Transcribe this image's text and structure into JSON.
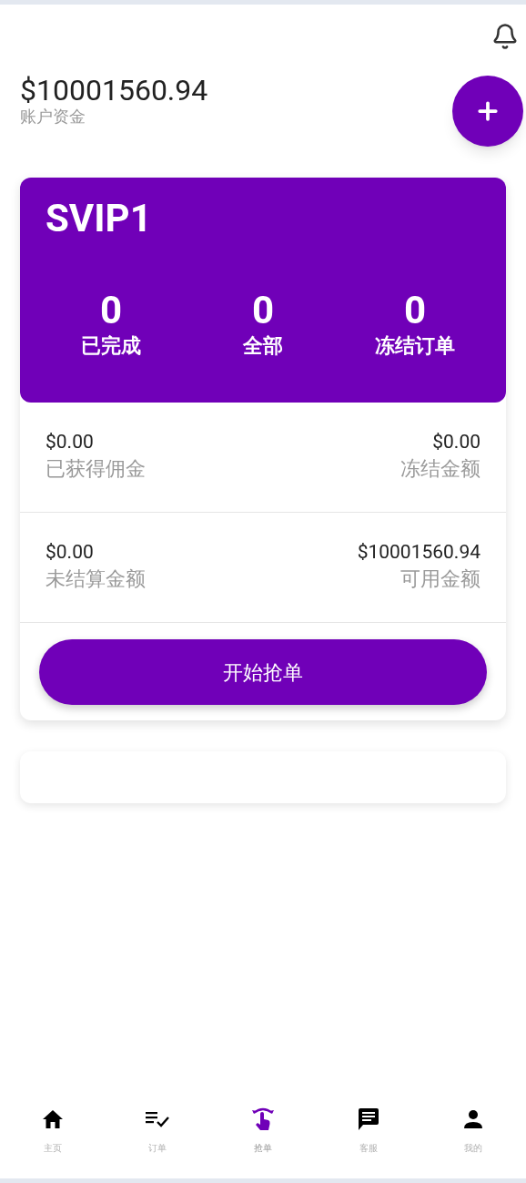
{
  "balance": {
    "amount": "$10001560.94",
    "label": "账户资金"
  },
  "vip_card": {
    "level": "SVIP1",
    "stats": [
      {
        "value": "0",
        "label": "已完成"
      },
      {
        "value": "0",
        "label": "全部"
      },
      {
        "value": "0",
        "label": "冻结订单"
      }
    ]
  },
  "summary_rows": [
    [
      {
        "amount": "$0.00",
        "label": "已获得佣金"
      },
      {
        "amount": "$0.00",
        "label": "冻结金额"
      }
    ],
    [
      {
        "amount": "$0.00",
        "label": "未结算金额"
      },
      {
        "amount": "$10001560.94",
        "label": "可用金额"
      }
    ]
  ],
  "start_button": "开始抢单",
  "bottom_nav": [
    {
      "label": "主页",
      "kind": "home",
      "selected": false
    },
    {
      "label": "订单",
      "kind": "orders",
      "selected": false
    },
    {
      "label": "抢单",
      "kind": "grab",
      "selected": true
    },
    {
      "label": "客服",
      "kind": "chat",
      "selected": false
    },
    {
      "label": "我的",
      "kind": "user",
      "selected": false
    }
  ]
}
